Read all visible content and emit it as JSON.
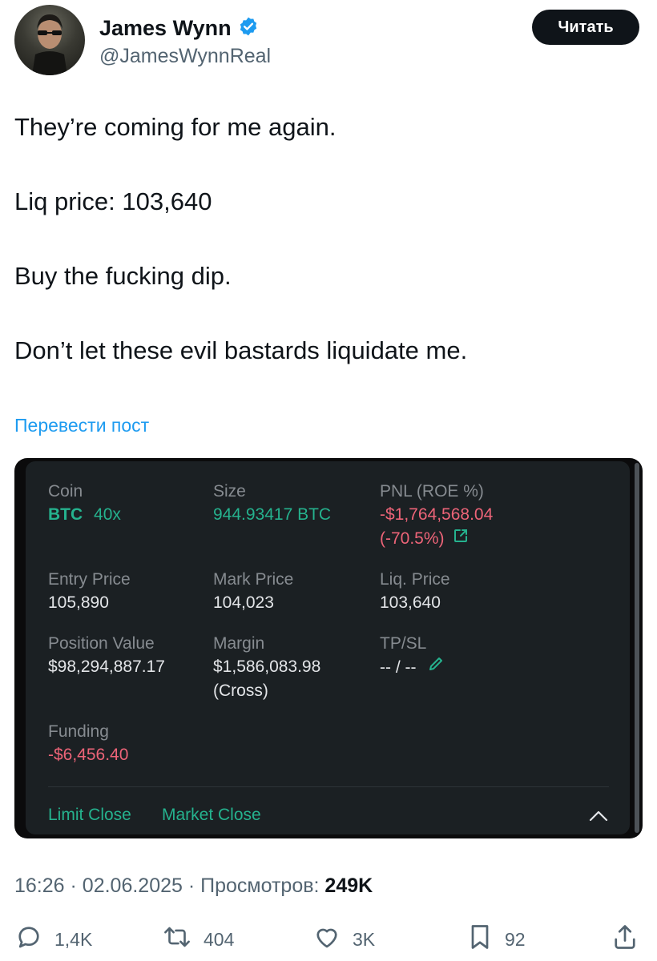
{
  "author": {
    "display_name": "James Wynn",
    "handle": "@JamesWynnReal",
    "verified_badge_icon": "verified-badge-icon",
    "follow_label": "Читать"
  },
  "post": {
    "lines": [
      "They’re coming for me again.",
      "Liq price: 103,640",
      "Buy the fucking dip.",
      "Don’t let these evil bastards liquidate me."
    ],
    "translate_label": "Перевести пост"
  },
  "position_card": {
    "coin_label": "Coin",
    "coin_value": "BTC",
    "leverage": "40x",
    "size_label": "Size",
    "size_value": "944.93417 BTC",
    "pnl_label": "PNL (ROE %)",
    "pnl_value": "-$1,764,568.04",
    "roe_value": "(-70.5%)",
    "entry_label": "Entry Price",
    "entry_value": "105,890",
    "mark_label": "Mark Price",
    "mark_value": "104,023",
    "liq_label": "Liq. Price",
    "liq_value": "103,640",
    "position_value_label": "Position Value",
    "position_value": "$98,294,887.17",
    "margin_label": "Margin",
    "margin_value": "$1,586,083.98",
    "margin_mode": "(Cross)",
    "tpsl_label": "TP/SL",
    "tpsl_value": "-- / --",
    "funding_label": "Funding",
    "funding_value": "-$6,456.40",
    "limit_close": "Limit Close",
    "market_close": "Market Close",
    "colors": {
      "green": "#25b28e",
      "red": "#ed6478",
      "background": "#1b2023"
    }
  },
  "meta": {
    "time": "16:26",
    "date": "02.06.2025",
    "views_label": "Просмотров:",
    "views_value": "249K"
  },
  "actions": {
    "replies": "1,4K",
    "reposts": "404",
    "likes": "3K",
    "bookmarks": "92"
  }
}
